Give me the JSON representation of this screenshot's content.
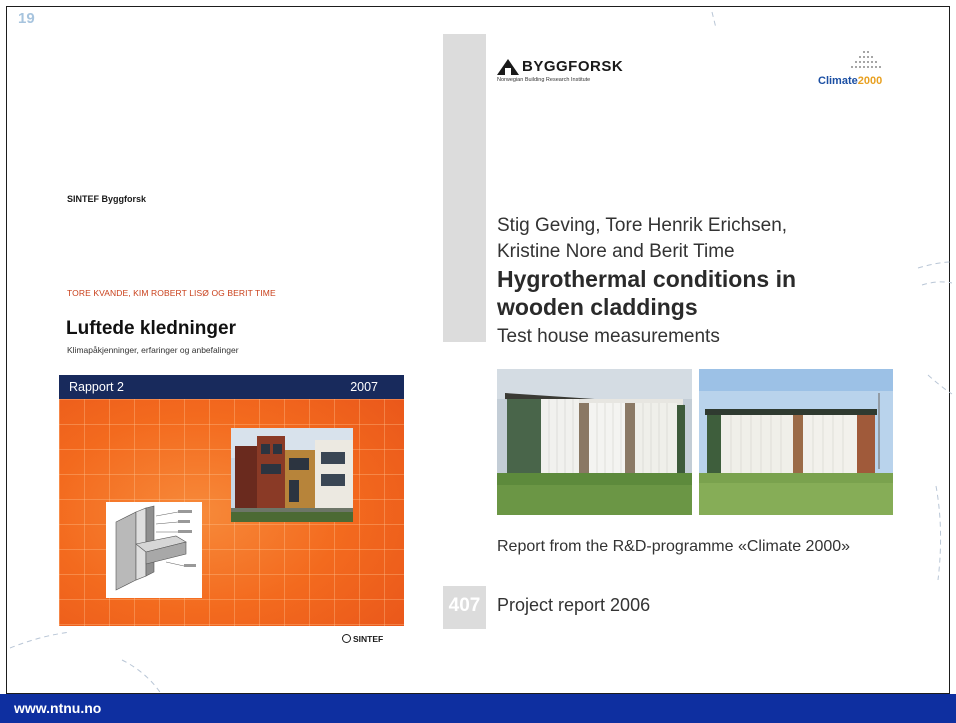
{
  "slide": {
    "number": "19"
  },
  "footer": {
    "url": "www.ntnu.no"
  },
  "left_cover": {
    "publisher": "SINTEF Byggforsk",
    "authors": "TORE KVANDE, KIM ROBERT LISØ OG BERIT TIME",
    "title": "Luftede kledninger",
    "subtitle": "Klimapåkjenninger, erfaringer og anbefalinger",
    "series_label": "Rapport 2",
    "year": "2007",
    "logo_text": "SINTEF",
    "colors": {
      "panel": "#f36a1e",
      "bar": "#182a5c"
    }
  },
  "right_cover": {
    "logo_name": "BYGGFORSK",
    "logo_subtitle": "Norwegian Building Research Institute",
    "partner_logo_word": "Climate",
    "partner_logo_year": "2000",
    "authors_line1": "Stig Geving, Tore Henrik Erichsen,",
    "authors_line2": "Kristine Nore and Berit Time",
    "title_line1": "Hygrothermal conditions in",
    "title_line2": "wooden claddings",
    "subtitle": "Test house measurements",
    "programme": "Report from the R&D-programme «Climate 2000»",
    "report_number": "407",
    "report_label": "Project report 2006"
  }
}
